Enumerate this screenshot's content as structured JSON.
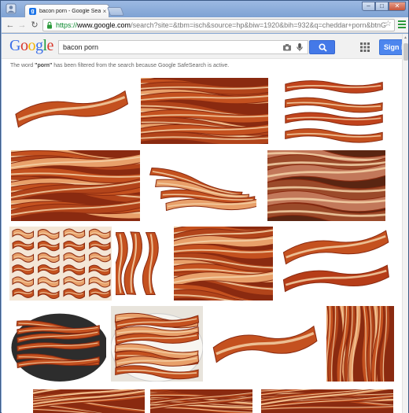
{
  "browser": {
    "tab_title": "bacon porn - Google Search",
    "tab_close": "×",
    "url_scheme": "https://",
    "url_host": "www.google.com",
    "url_path": "/search?site=&tbm=isch&source=hp&biw=1920&bih=932&q=cheddar+porn&btnG",
    "controls": {
      "minimize": "–",
      "maximize": "□",
      "close": "✕"
    },
    "nav": {
      "back": "←",
      "forward": "→",
      "reload": "↻"
    },
    "bookmark_star": "☆"
  },
  "google": {
    "logo_letters": [
      "G",
      "o",
      "o",
      "g",
      "l",
      "e"
    ],
    "search_query": "bacon porn",
    "signin_label": "Sign in"
  },
  "safesearch_notice": {
    "prefix": "The word ",
    "word": "\"porn\"",
    "suffix": " has been filtered from the search because Google SafeSearch is active."
  },
  "results": [
    {
      "name": "result-image-1",
      "style": "single-strip-white"
    },
    {
      "name": "result-image-2",
      "style": "pile"
    },
    {
      "name": "result-image-3",
      "style": "stacked-strips-white"
    },
    {
      "name": "result-image-4",
      "style": "pile"
    },
    {
      "name": "result-image-5",
      "style": "curly-white"
    },
    {
      "name": "result-image-6",
      "style": "closeup-dark"
    },
    {
      "name": "result-image-7",
      "style": "rows"
    },
    {
      "name": "result-image-8",
      "style": "vertical-strips-white"
    },
    {
      "name": "result-image-9",
      "style": "pile"
    },
    {
      "name": "result-image-10",
      "style": "two-strips-white"
    },
    {
      "name": "result-image-11",
      "style": "pan"
    },
    {
      "name": "result-image-12",
      "style": "plate"
    },
    {
      "name": "result-image-13",
      "style": "single-strip-white"
    },
    {
      "name": "result-image-14",
      "style": "vertical-pile"
    },
    {
      "name": "result-image-15",
      "style": "pile"
    },
    {
      "name": "result-image-16",
      "style": "pile"
    },
    {
      "name": "result-image-17",
      "style": "pile"
    }
  ],
  "colors": {
    "bacon_dark": "#8a2a10",
    "bacon_mid": "#c4511f",
    "bacon_light": "#e8a06a",
    "fat": "#f3d2a8",
    "accent_blue": "#4479e8"
  }
}
